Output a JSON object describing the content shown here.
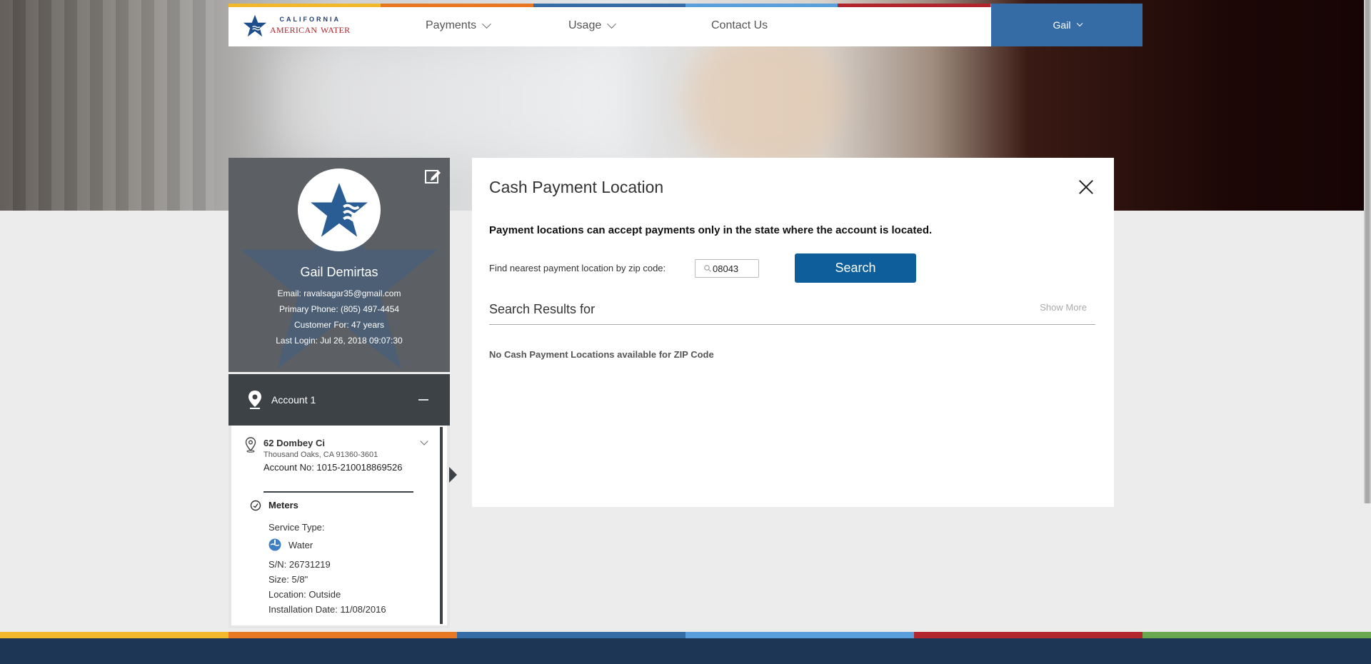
{
  "brand": {
    "line1": "CALIFORNIA",
    "line2": "AMERICAN WATER"
  },
  "colors": {
    "stripe": [
      "#f2b82c",
      "#e87722",
      "#356ca6",
      "#5a9fdc",
      "#b0262c",
      "#6aa84f"
    ],
    "nav_user_bg": "#356ca6",
    "primary_button": "#0d5e9b",
    "footer": "#1e3655"
  },
  "nav": {
    "items": [
      {
        "label": "Payments",
        "icon": "chevron-down-icon"
      },
      {
        "label": "Usage",
        "icon": "chevron-down-icon"
      },
      {
        "label": "Contact Us"
      }
    ],
    "user": {
      "label": "Gail",
      "icon": "chevron-down-icon"
    }
  },
  "profile": {
    "name": "Gail Demirtas",
    "email": "Email: ravalsagar35@gmail.com",
    "phone": "Primary Phone: (805) 497-4454",
    "customer_for": "Customer For: 47 years",
    "last_login": "Last Login: Jul 26, 2018 09:07:30",
    "edit_icon": "edit-icon"
  },
  "account": {
    "title": "Account 1",
    "address_line1": "62 Dombey Ci",
    "address_line2": "Thousand Oaks, CA 91360-3601",
    "account_no": "Account No: 1015-210018869526",
    "meters_label": "Meters",
    "service_type": "Service Type:",
    "service": "Water",
    "serial": "S/N: 26731219",
    "size": "Size: 5/8\"",
    "location": "Location: Outside",
    "install_date": "Installation Date: 11/08/2016"
  },
  "modal": {
    "title": "Cash Payment Location",
    "note": "Payment locations can accept payments only in the state where the account is located.",
    "find_label": "Find nearest payment location by zip code:",
    "zip_value": "08043",
    "search_label": "Search",
    "results_title": "Search Results for",
    "show_more": "Show More",
    "no_results": "No Cash Payment Locations available for ZIP Code"
  }
}
